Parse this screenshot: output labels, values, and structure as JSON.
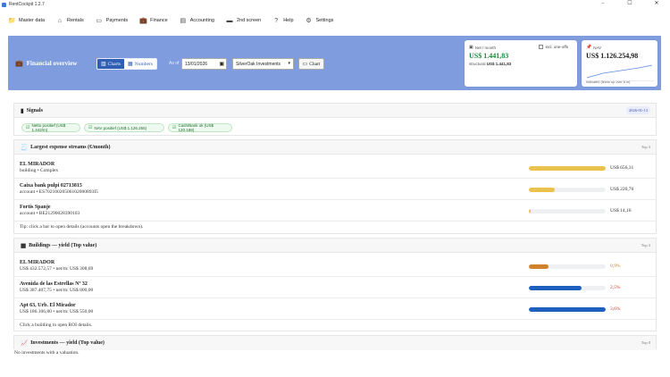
{
  "window": {
    "title": "RentCockpit 1.2.7",
    "controls": [
      "–",
      "☐",
      "✕"
    ]
  },
  "menu": [
    {
      "name": "menu-master-data",
      "icon": "folder-icon",
      "glyph": "📁",
      "label": "Master data"
    },
    {
      "name": "menu-rentals",
      "icon": "house-icon",
      "glyph": "⌂",
      "label": "Rentals"
    },
    {
      "name": "menu-payments",
      "icon": "card-icon",
      "glyph": "▭",
      "label": "Payments"
    },
    {
      "name": "menu-finance",
      "icon": "briefcase-icon",
      "glyph": "💼",
      "label": "Finance"
    },
    {
      "name": "menu-accounting",
      "icon": "ledger-icon",
      "glyph": "▤",
      "label": "Accounting"
    },
    {
      "name": "menu-2nd-screen",
      "icon": "monitor-icon",
      "glyph": "▬",
      "label": "2nd screen"
    },
    {
      "name": "menu-help",
      "icon": "question-icon",
      "glyph": "?",
      "label": "Help"
    },
    {
      "name": "menu-settings",
      "icon": "gear-icon",
      "glyph": "⚙",
      "label": "Settings"
    }
  ],
  "hero": {
    "title": "Financial overview",
    "tabs": {
      "charts": "Charts",
      "numbers": "Numbers"
    },
    "as_of_label": "As of",
    "date_value": "13/01/2026",
    "portfolio_value": "SilverOak Investments",
    "chart_button": "Chart",
    "accent": "#7e9cde"
  },
  "net_card": {
    "label": "Net / month",
    "value": "US$ 1.441,83",
    "structural_label": "structural",
    "structural_value": "US$ 1.441,83",
    "checkbox_label": "incl. one-offs",
    "value_color": "#1e8a3c"
  },
  "nav_card": {
    "label": "NAV",
    "value": "US$ 1.126.254,98",
    "hint": "Indicated (linear up over 6 m)"
  },
  "signals": {
    "title": "Signals",
    "date": "2026-01-13",
    "pills": [
      "Netto positief (US$ 1.442/m)",
      "NAV positief (US$ 1.126.255)",
      "Cash/Bank ok (US$ 120.188)"
    ]
  },
  "expenses": {
    "title": "Largest expense streams (€/month)",
    "badge": "Top 3",
    "rows": [
      {
        "name": "EL MIRADOR",
        "meta": "building • Complex",
        "amount": "US$ 656,31",
        "fraction": 1.0,
        "color": "#ecc24f"
      },
      {
        "name": "Caixa bank pulpi 02713815",
        "meta": "account • ES70210020506102000893I5",
        "amount": "US$ 220,76",
        "fraction": 0.34,
        "color": "#ecc24f"
      },
      {
        "name": "Fortis Spanje",
        "meta": "account • BE21290028390103",
        "amount": "US$ 14,16",
        "fraction": 0.022,
        "color": "#ecc24f"
      }
    ],
    "tip": "Tip: click a bar to open details (accounts open the breakdown)."
  },
  "buildings": {
    "title": "Buildings — yield (Top value)",
    "badge": "Top 3",
    "rows": [
      {
        "name": "EL MIRADOR",
        "meta": "US$ 432.572,57 • net/m: US$ 308,69",
        "pct": "0,9%",
        "fraction": 0.25,
        "color": "#d0822a",
        "pct_color": "#d0822a"
      },
      {
        "name": "Avenida de las Estrellas Nº 32",
        "meta": "US$ 387.407,75 • net/m: US$ 800,00",
        "pct": "2,5%",
        "fraction": 0.69,
        "color": "#1f5fbf",
        "pct_color": "#c0392b"
      },
      {
        "name": "Apt 63, Urb. El Mirador",
        "meta": "US$ 186.106,80 • net/m: US$ 550,00",
        "pct": "3,6%",
        "fraction": 1.0,
        "color": "#1f5fbf",
        "pct_color": "#c0392b"
      }
    ],
    "tip": "Click a building to open ROI details."
  },
  "investments": {
    "title": "Investments — yield (Top value)",
    "badge": "Top 0",
    "empty": "No investments with a valuation."
  }
}
